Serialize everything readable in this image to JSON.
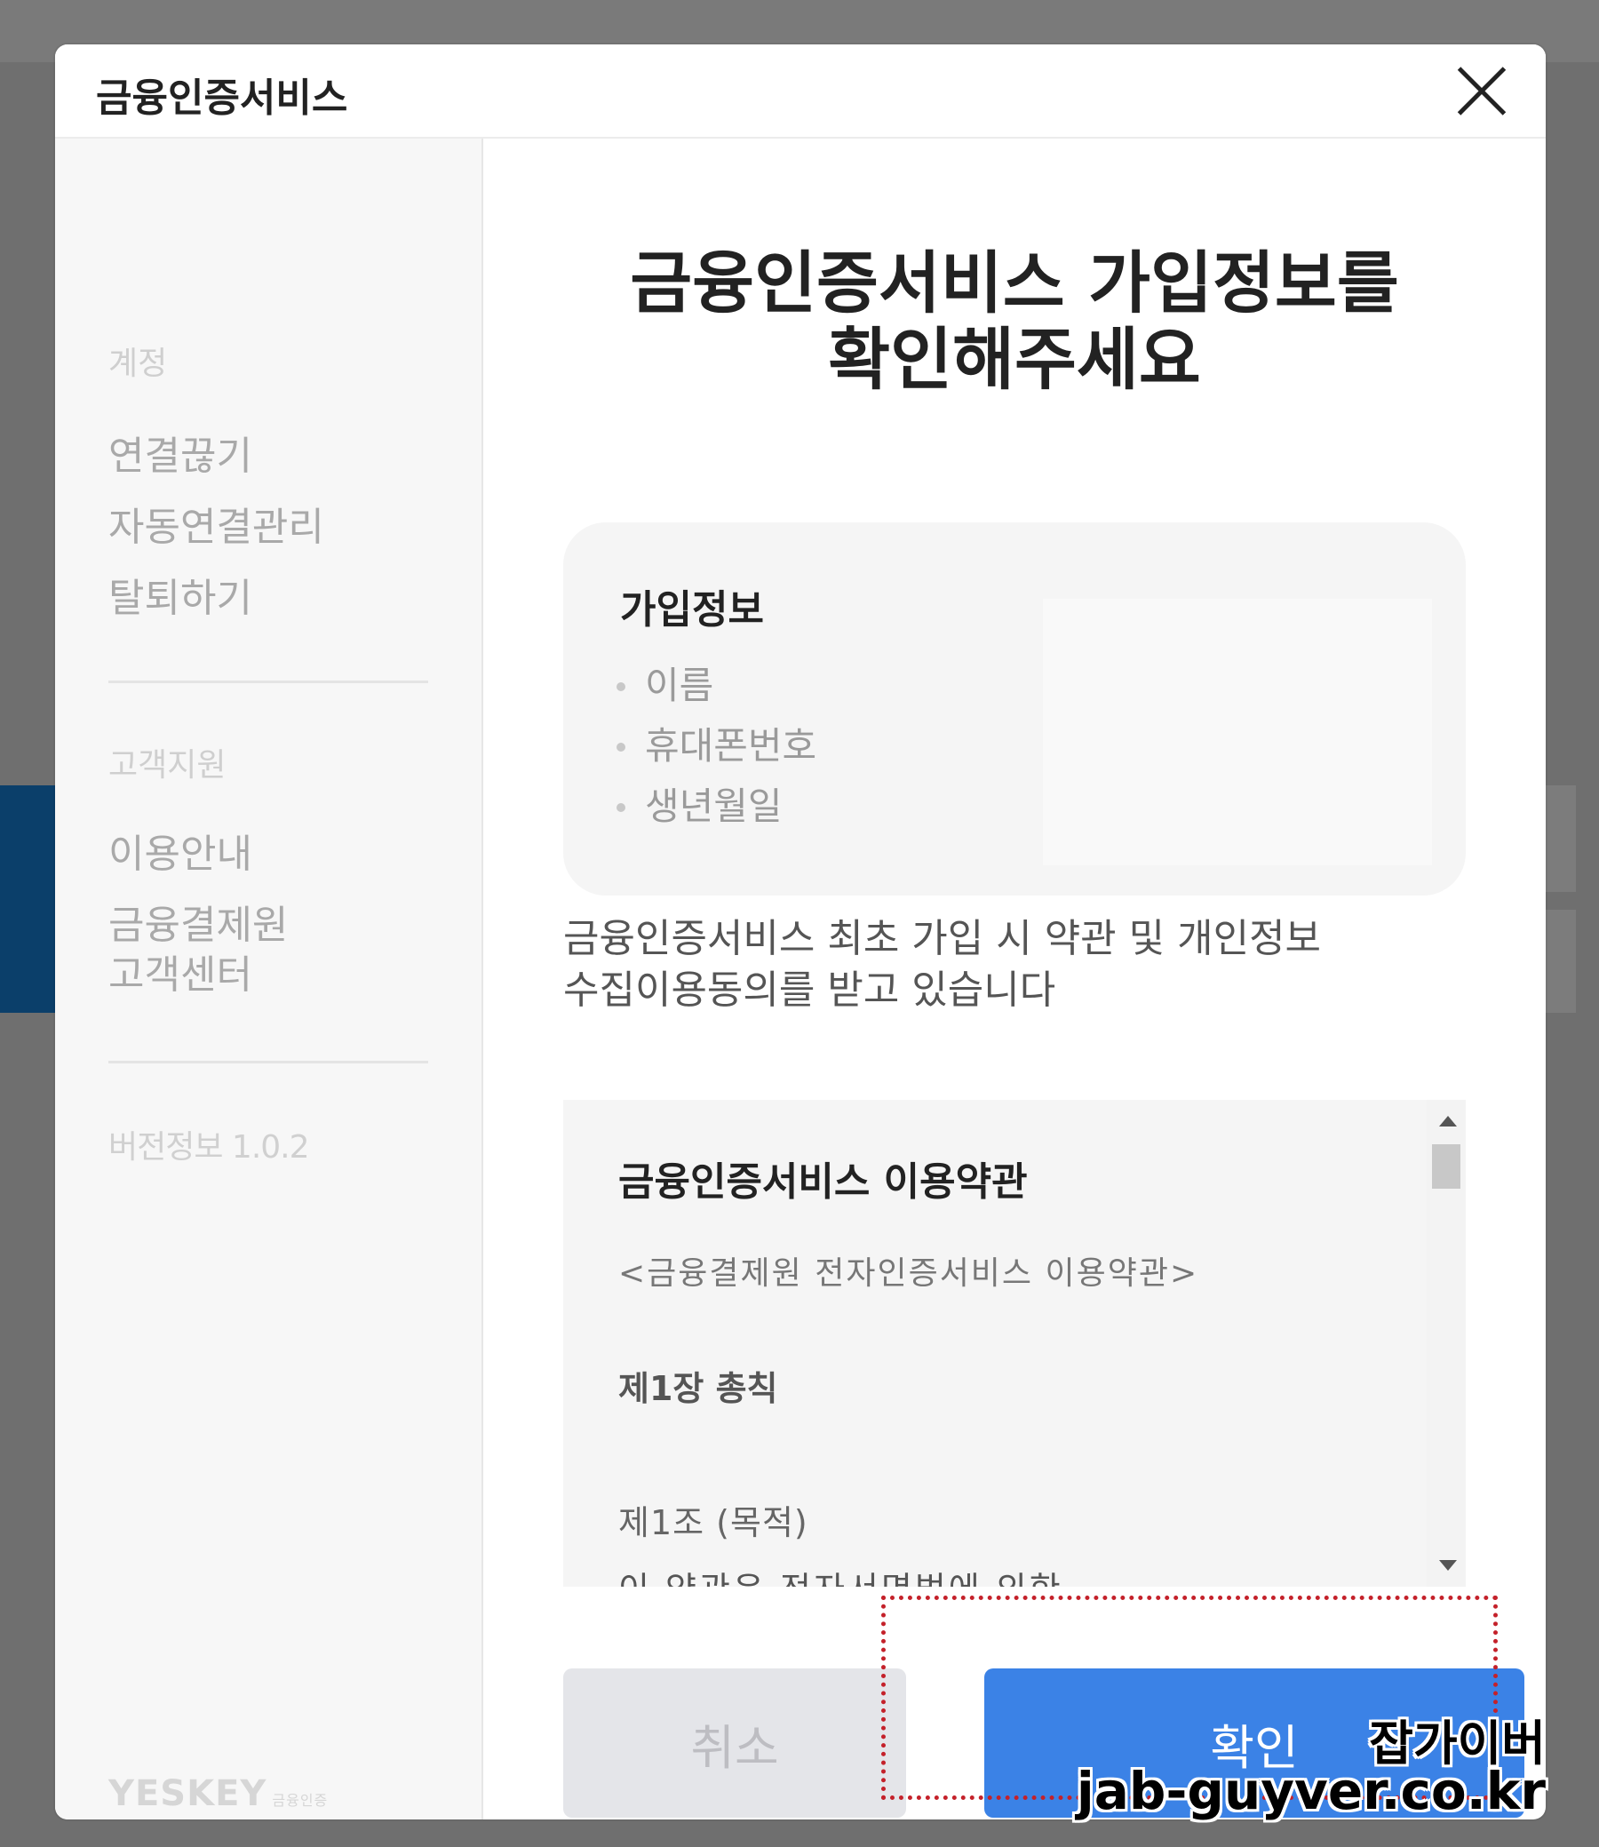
{
  "modal": {
    "title": "금융인증서비스",
    "close_icon": "close-icon"
  },
  "sidebar": {
    "section_account": "계정",
    "account_items": [
      "연결끊기",
      "자동연결관리",
      "탈퇴하기"
    ],
    "section_support": "고객지원",
    "support_items": [
      "이용안내",
      "금융결제원\n고객센터"
    ],
    "version": "버전정보 1.0.2",
    "logo": "YESKEY",
    "logo_sub": "금융인증"
  },
  "main": {
    "heading_line1": "금융인증서비스 가입정보를",
    "heading_line2": "확인해주세요",
    "info_title": "가입정보",
    "info_items": [
      "이름",
      "휴대폰번호",
      "생년월일"
    ],
    "notice_line1": "금융인증서비스 최초 가입 시 약관 및 개인정보",
    "notice_line2": "수집이용동의를 받고 있습니다",
    "terms": {
      "title": "금융인증서비스 이용약관",
      "subtitle": "<금융결제원 전자인증서비스 이용약관>",
      "chapter": "제1장 총칙",
      "article": "제1조 (목적)",
      "line": "이 약관은 전자서명법에 의한"
    },
    "cancel_label": "취소",
    "confirm_label": "확인"
  },
  "watermark": {
    "name": "잡가이버",
    "url": "jab-guyver.co.kr"
  },
  "colors": {
    "confirm": "#3b82e6",
    "cancel": "#e4e5e9",
    "highlight": "#c4212a"
  }
}
